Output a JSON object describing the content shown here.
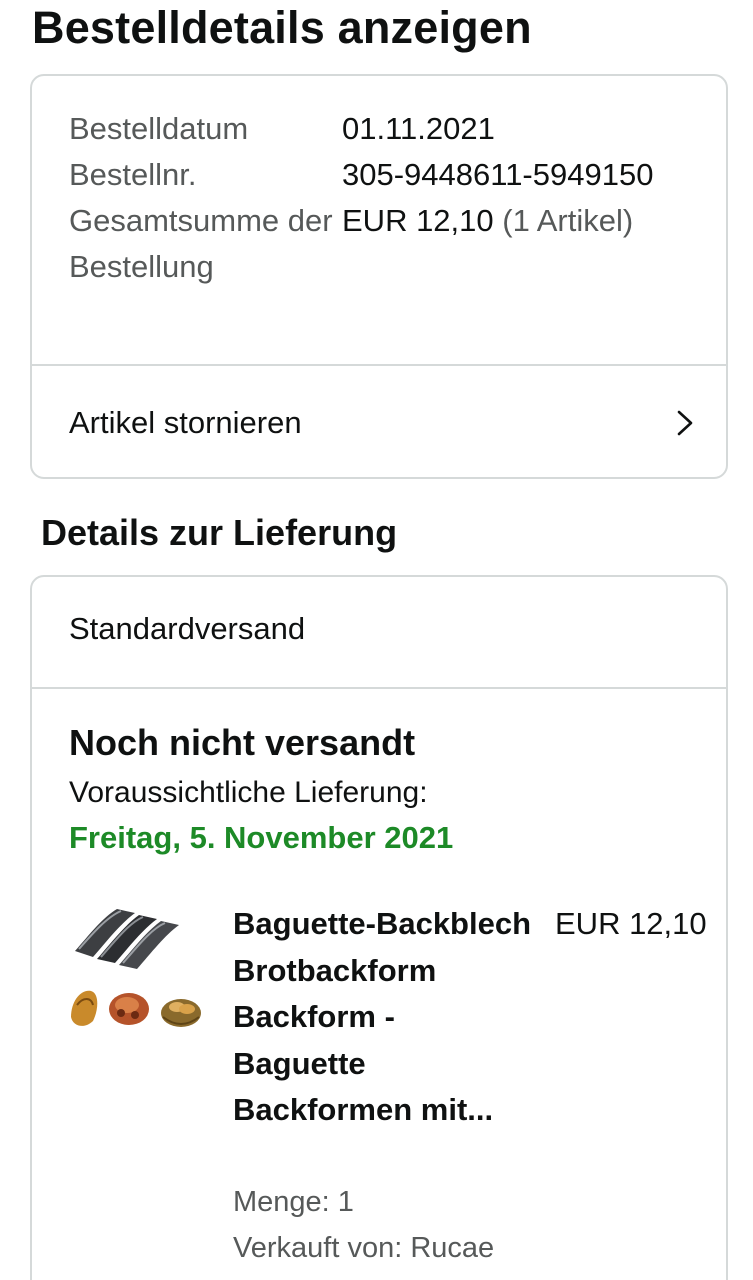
{
  "page_title": "Bestelldetails anzeigen",
  "order_summary": {
    "rows": [
      {
        "label": "Bestelldatum",
        "value": "01.11.2021"
      },
      {
        "label": "Bestellnr.",
        "value": "305-9448611-5949150"
      }
    ],
    "total": {
      "label": "Gesamtsumme der Bestellung",
      "amount": "EUR 12,10",
      "items_note": "(1 Artikel)"
    },
    "cancel_action": "Artikel stornieren"
  },
  "delivery": {
    "section_title": "Details zur Lieferung",
    "shipping_method": "Standardversand",
    "status": "Noch nicht versandt",
    "expected_label": "Voraussichtliche Lieferung:",
    "expected_date": "Freitag, 5. November 2021",
    "date_color": "#1d8a27"
  },
  "product": {
    "name": "Baguette-Backblech Brotbackform Backform - Baguette Backformen mit...",
    "price": "EUR 12,10",
    "quantity": "Menge: 1",
    "seller": "Verkauft von: Rucae",
    "image_icon": "baguette-tray-icon"
  }
}
